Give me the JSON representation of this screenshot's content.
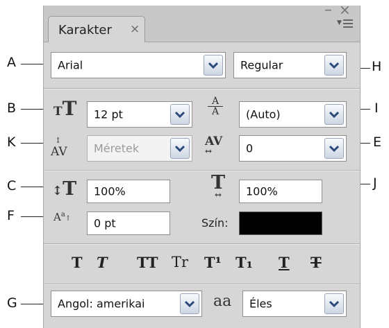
{
  "panel": {
    "tab_label": "Karakter",
    "tab_close": "×",
    "window_minimize": "–",
    "window_close": "×"
  },
  "font_family": {
    "value": "Arial"
  },
  "font_style": {
    "value": "Regular"
  },
  "font_size": {
    "value": "12 pt"
  },
  "leading": {
    "value": "(Auto)"
  },
  "kerning": {
    "value": "Méretek"
  },
  "tracking": {
    "value": "0"
  },
  "vertical_scale": {
    "value": "100%"
  },
  "horizontal_scale": {
    "value": "100%"
  },
  "baseline_shift": {
    "value": "0 pt"
  },
  "color": {
    "label": "Szín:",
    "swatch": "#000000"
  },
  "style_buttons": [
    "T",
    "T",
    "TT",
    "Tr",
    "T¹",
    "T₁",
    "T",
    "T"
  ],
  "language": {
    "value": "Angol: amerikai"
  },
  "antialias": {
    "icon_text": "aa",
    "value": "Éles"
  },
  "callouts": {
    "A": "A",
    "B": "B",
    "C": "C",
    "E": "E",
    "F": "F",
    "G": "G",
    "H": "H",
    "I": "I",
    "J": "J",
    "K": "K"
  }
}
